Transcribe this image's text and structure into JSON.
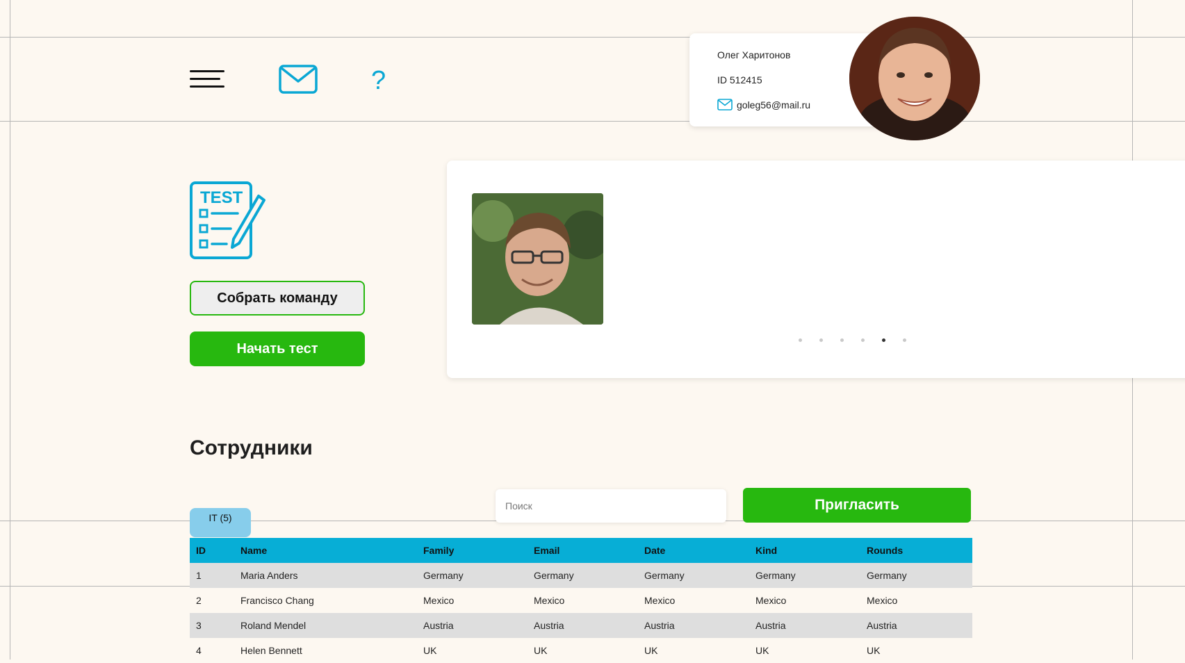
{
  "header": {
    "menu_icon": "hamburger-icon",
    "mail_icon": "envelope-icon",
    "help_label": "?"
  },
  "profile": {
    "name": "Олег Харитонов",
    "id": "ID 512415",
    "email": "goleg56@mail.ru"
  },
  "actions": {
    "test_icon_text": "TEST",
    "team_button": "Собрать команду",
    "start_button": "Начать тест"
  },
  "carousel": {
    "dots": 6,
    "active_dot": 5
  },
  "employees": {
    "title": "Сотрудники",
    "search_placeholder": "Поиск",
    "invite_button": "Пригласить",
    "tab_label": "IT (5)",
    "columns": [
      "ID",
      "Name",
      "Family",
      "Email",
      "Date",
      "Kind",
      "Rounds"
    ],
    "rows": [
      [
        "1",
        "Maria Anders",
        "Germany",
        "Germany",
        "Germany",
        "Germany",
        "Germany"
      ],
      [
        "2",
        "Francisco Chang",
        "Mexico",
        "Mexico",
        "Mexico",
        "Mexico",
        "Mexico"
      ],
      [
        "3",
        "Roland Mendel",
        "Austria",
        "Austria",
        "Austria",
        "Austria",
        "Austria"
      ],
      [
        "4",
        "Helen Bennett",
        "UK",
        "UK",
        "UK",
        "UK",
        "UK"
      ]
    ]
  },
  "colors": {
    "accent": "#0aa7d4",
    "green": "#27b80f",
    "table_header": "#07aed6",
    "tab": "#87cdeb",
    "background": "#fdf8f1"
  }
}
